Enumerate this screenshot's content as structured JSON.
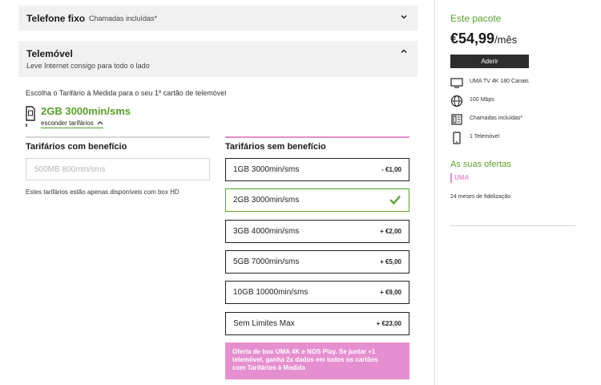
{
  "accordions": {
    "fixo": {
      "title": "Telefone fixo",
      "subtitle": "Chamadas incluídas*",
      "state": "collapsed"
    },
    "movel": {
      "title": "Telemóvel",
      "subtitle": "Leve Internet consigo para todo o lado",
      "state": "expanded"
    }
  },
  "mobile": {
    "intro": "Escolha o Tarifário à Medida para o seu 1º cartão de telemóvel",
    "selected_plan": "2GB 3000min/sms",
    "hide_link": "esconder tarifários"
  },
  "columns": {
    "with_benefit": {
      "heading": "Tarifários com benefício",
      "disabled_option": "500MB 800min/sms",
      "note": "Estes tarifários estão apenas disponíveis com box HD"
    },
    "without_benefit": {
      "heading": "Tarifários sem benefício",
      "plans": [
        {
          "name": "1GB 3000min/sms",
          "price": "- €1,00",
          "selected": false
        },
        {
          "name": "2GB 3000min/sms",
          "price": "",
          "selected": true
        },
        {
          "name": "3GB 4000min/sms",
          "price": "+ €2,00",
          "selected": false
        },
        {
          "name": "5GB 7000min/sms",
          "price": "+ €5,00",
          "selected": false
        },
        {
          "name": "10GB 10000min/sms",
          "price": "+ €9,00",
          "selected": false
        },
        {
          "name": "Sem Limites Max",
          "price": "+ €23,00",
          "selected": false
        }
      ]
    }
  },
  "promo": {
    "line1": "Oferta de box UMA 4K e NOS Play. Se juntar +1",
    "line2": "telemóvel, ganha 2x dados em todos os cartões",
    "line3": "com Tarifários à Medida"
  },
  "sidebar": {
    "title": "Este pacote",
    "price": "€54,99",
    "per": "/mês",
    "join": "Aderir",
    "features": [
      {
        "icon": "tv-icon",
        "text": "UMA TV 4K 180 Canais"
      },
      {
        "icon": "globe-icon",
        "text": "100 Mbps"
      },
      {
        "icon": "phone-icon",
        "text": "Chamadas incluídas*"
      },
      {
        "icon": "mobile-icon",
        "text": "1 Telemóvel"
      }
    ],
    "offers_title": "As suas ofertas",
    "offer_tag": "UMA",
    "fidelization": "24 meses de fidelização"
  },
  "colors": {
    "green": "#5aa02c",
    "pink": "#e58fd0",
    "dark": "#2d2d2d",
    "panel": "#f1f1f1"
  }
}
